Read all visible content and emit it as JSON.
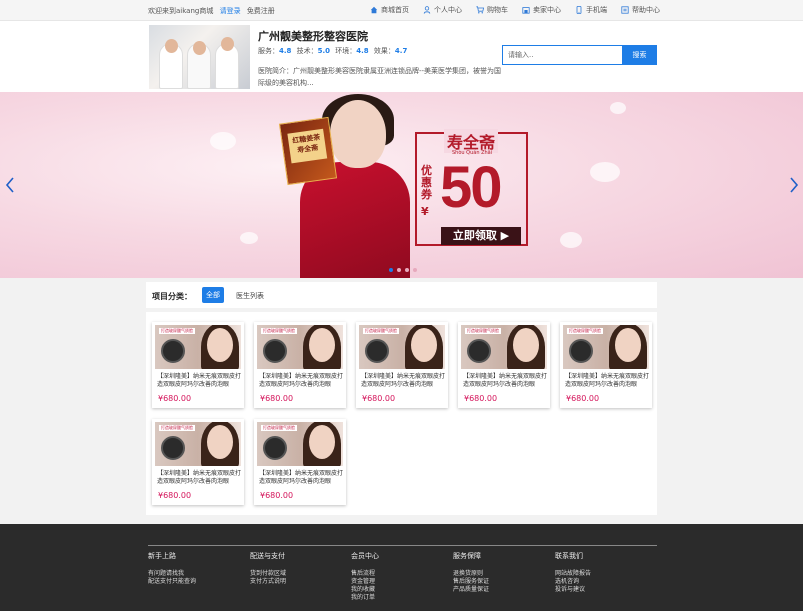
{
  "topbar": {
    "welcome": "欢迎来到aikang商城",
    "login": "请登录",
    "register": "免费注册",
    "nav": [
      {
        "label": "商城首页",
        "icon": "home-icon"
      },
      {
        "label": "个人中心",
        "icon": "user-icon"
      },
      {
        "label": "购物车",
        "icon": "cart-icon"
      },
      {
        "label": "卖家中心",
        "icon": "store-icon"
      },
      {
        "label": "手机端",
        "icon": "phone-icon"
      },
      {
        "label": "帮助中心",
        "icon": "help-icon"
      }
    ]
  },
  "shop": {
    "name": "广州靓美整形整容医院",
    "ratings": [
      {
        "label": "服务：",
        "value": "4.8"
      },
      {
        "label": "技术：",
        "value": "5.0"
      },
      {
        "label": "环境：",
        "value": "4.8"
      },
      {
        "label": "效果：",
        "value": "4.7"
      }
    ],
    "intro": "医院简介：广州靓美整形美容医院隶属亚洲连锁品牌--美莱医学集团，被誉为国际级的美容机构..."
  },
  "search": {
    "placeholder": "请输入..",
    "button": "搜索"
  },
  "banner": {
    "brand": "寿全斋",
    "brand_pinyin": "Shòu Quán Zhāi",
    "product_label": "红糖姜茶 寿全斋",
    "coupon_label": "优惠券",
    "currency": "¥",
    "coupon_value": "50",
    "claim": "立即领取 ▶",
    "slides": 4,
    "active_slide": 1
  },
  "category": {
    "title": "项目分类：",
    "tabs": [
      "全部",
      "医生列表"
    ]
  },
  "products": [
    {
      "tag": "打造玻尿酸气质脸",
      "desc": "【深圳隆美】纳米无痕双眼皮打造双眼皮阿玛尔改善肉泡眼",
      "price": "¥680.00"
    },
    {
      "tag": "打造玻尿酸气质脸",
      "desc": "【深圳隆美】纳米无痕双眼皮打造双眼皮阿玛尔改善肉泡眼",
      "price": "¥680.00"
    },
    {
      "tag": "打造玻尿酸气质脸",
      "desc": "【深圳隆美】纳米无痕双眼皮打造双眼皮阿玛尔改善肉泡眼",
      "price": "¥680.00"
    },
    {
      "tag": "打造玻尿酸气质脸",
      "desc": "【深圳隆美】纳米无痕双眼皮打造双眼皮阿玛尔改善肉泡眼",
      "price": "¥680.00"
    },
    {
      "tag": "打造玻尿酸气质脸",
      "desc": "【深圳隆美】纳米无痕双眼皮打造双眼皮阿玛尔改善肉泡眼",
      "price": "¥680.00"
    },
    {
      "tag": "打造玻尿酸气质脸",
      "desc": "【深圳隆美】纳米无痕双眼皮打造双眼皮阿玛尔改善肉泡眼",
      "price": "¥680.00"
    },
    {
      "tag": "打造玻尿酸气质脸",
      "desc": "【深圳隆美】纳米无痕双眼皮打造双眼皮阿玛尔改善肉泡眼",
      "price": "¥680.00"
    }
  ],
  "footer": [
    {
      "title": "新手上路",
      "links": [
        "有问题请找我",
        "配送支付只能查询"
      ]
    },
    {
      "title": "配送与支付",
      "links": [
        "货到付款区域",
        "支付方式说明"
      ]
    },
    {
      "title": "会员中心",
      "links": [
        "售后流程",
        "资金管理",
        "我的收藏",
        "我的订单"
      ]
    },
    {
      "title": "服务保障",
      "links": [
        "退换货原则",
        "售后服务保证",
        "产品质量保证"
      ]
    },
    {
      "title": "联系我们",
      "links": [
        "网站故障报告",
        "选机咨询",
        "投诉与建议"
      ]
    }
  ],
  "colors": {
    "accent": "#1e7de6",
    "price": "#d4145a",
    "coupon": "#b31a2a",
    "footer_bg": "#2b2b2b"
  }
}
